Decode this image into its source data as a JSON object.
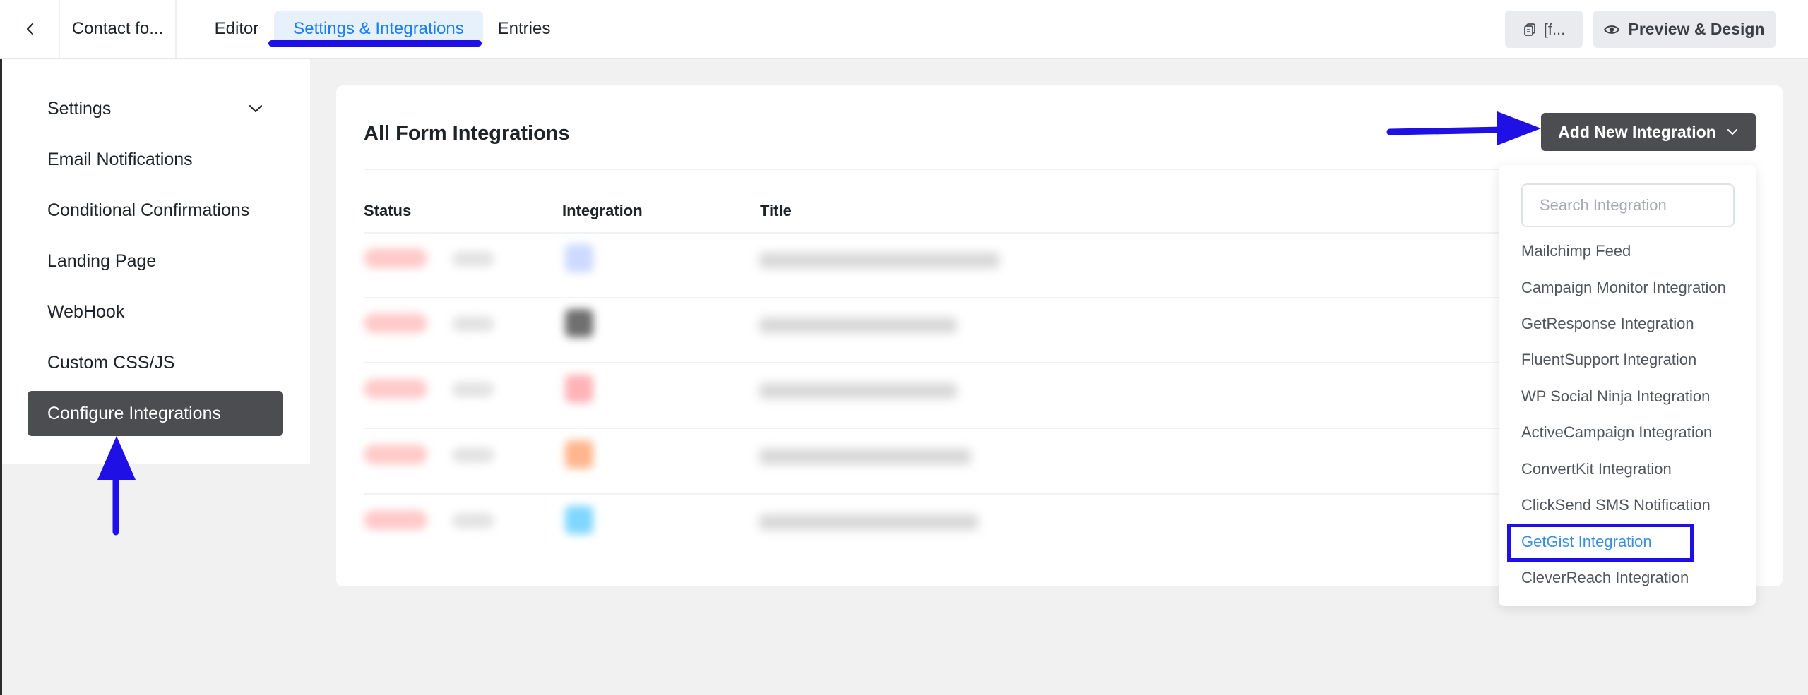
{
  "topbar": {
    "form_name": "Contact fo...",
    "tabs": [
      {
        "label": "Editor"
      },
      {
        "label": "Settings & Integrations",
        "active": true
      },
      {
        "label": "Entries"
      }
    ],
    "shortcode_label": "[f...",
    "preview_label": "Preview & Design"
  },
  "sidebar": {
    "items": [
      {
        "label": "Settings",
        "has_chevron": true
      },
      {
        "label": "Email Notifications"
      },
      {
        "label": "Conditional Confirmations"
      },
      {
        "label": "Landing Page"
      },
      {
        "label": "WebHook"
      },
      {
        "label": "Custom CSS/JS"
      },
      {
        "label": "Configure Integrations",
        "active": true
      }
    ]
  },
  "main": {
    "title": "All Form Integrations",
    "add_button_label": "Add New Integration",
    "columns": [
      "Status",
      "Integration",
      "Title"
    ]
  },
  "dropdown": {
    "search_placeholder": "Search Integration",
    "items": [
      "Mailchimp Feed",
      "Campaign Monitor Integration",
      "GetResponse Integration",
      "FluentSupport Integration",
      "WP Social Ninja Integration",
      "ActiveCampaign Integration",
      "ConvertKit Integration",
      "ClickSend SMS Notification",
      "GetGist Integration",
      "CleverReach Integration"
    ],
    "highlighted_index": 8
  },
  "colors": {
    "accent": "#1a7efb",
    "active_sidebar": "#4b4d50",
    "annotation_blue": "#1f10e6",
    "highlighted_item": "#3b8fe0"
  }
}
